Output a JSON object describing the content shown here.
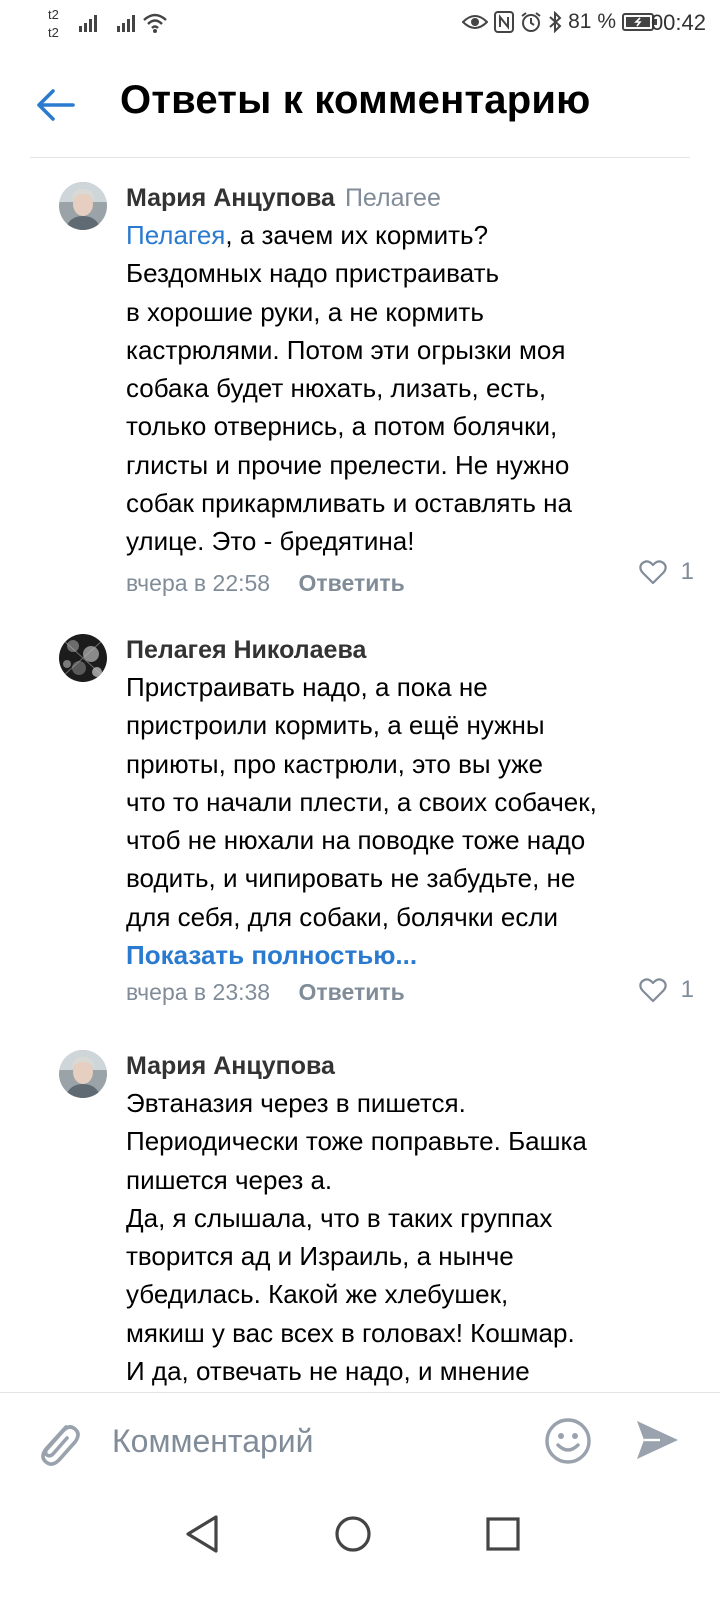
{
  "status_bar": {
    "sim1": "t2",
    "sim2": "t2",
    "battery": "81 %",
    "time": "00:42"
  },
  "header": {
    "title": "Ответы к комментарию"
  },
  "comments": [
    {
      "author": "Мария Анцупова",
      "reply_to": "Пелагее",
      "mention": "Пелагея",
      "text": ", а зачем их кормить?\nБездомных надо пристраивать\nв хорошие руки, а не кормить\nкастрюлями. Потом эти огрызки моя\nсобака будет нюхать, лизать, есть,\nтолько отвернись, а потом болячки,\nглисты и прочие прелести. Не нужно\nсобак прикармливать и оставлять на\nулице. Это - бредятина!",
      "timestamp": "вчера в 22:58",
      "reply_label": "Ответить",
      "likes": "1"
    },
    {
      "author": "Пелагея Николаева",
      "text": "Пристраивать надо, а пока не\nпристроили кормить, а ещё нужны\nприюты, про кастрюли, это вы уже\nчто то начали плести, а своих собачек,\nчтоб не нюхали на поводке тоже надо\nводить, и чипировать не забудьте, не\nдля себя, для собаки, болячки если",
      "show_full": "Показать полностью...",
      "timestamp": "вчера в 23:38",
      "reply_label": "Ответить",
      "likes": "1"
    },
    {
      "author": "Мария Анцупова",
      "text": "Эвтаназия через в пишется.\nПериодически тоже поправьте. Башка\nпишется через а.\nДа, я слышала, что в таких группах\nтворится ад и Израиль, а нынче\nубедилась. Какой же хлебушек,\nмякиш у вас всех в головах! Кошмар.\nИ да, отвечать не надо, и мнение"
    }
  ],
  "input": {
    "placeholder": "Комментарий"
  },
  "icons": {
    "back": "arrow-left-icon",
    "like": "heart-icon",
    "attach": "paperclip-icon",
    "emoji": "smile-icon",
    "send": "send-icon"
  },
  "colors": {
    "accent": "#2a7bd0",
    "secondary_text": "#818c99",
    "author_text": "#333333"
  }
}
